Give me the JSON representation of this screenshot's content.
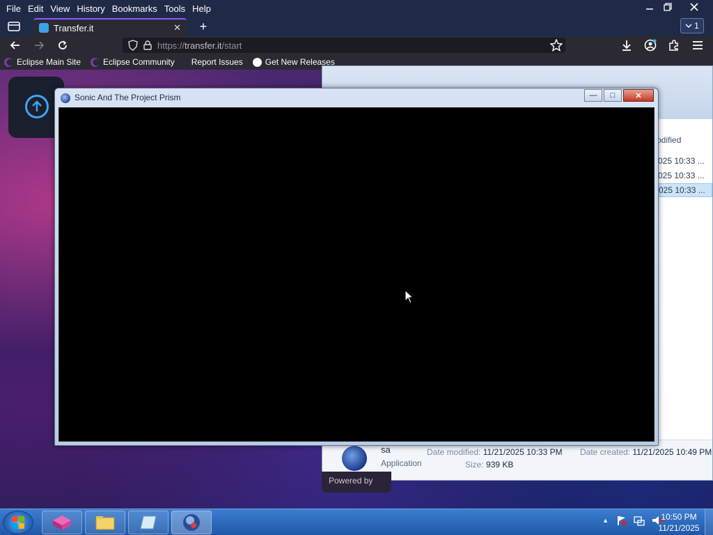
{
  "browser": {
    "menu": [
      "File",
      "Edit",
      "View",
      "History",
      "Bookmarks",
      "Tools",
      "Help"
    ],
    "tab": {
      "title": "Transfer.it",
      "close_glyph": "✕"
    },
    "new_tab_glyph": "+",
    "tab_count": "1",
    "url": {
      "scheme": "https://",
      "host": "transfer.it",
      "path": "/start"
    },
    "bookmarks": [
      {
        "label": "Eclipse Main Site",
        "icon": "eclipse-icon"
      },
      {
        "label": "Eclipse Community",
        "icon": "eclipse-icon"
      },
      {
        "label": "Report Issues",
        "icon": ""
      },
      {
        "label": "Get New Releases",
        "icon": "github-icon"
      }
    ],
    "colors": {
      "accent": "#9059ff",
      "chrome": "#1f2a47",
      "toolbar": "#2b2a33"
    }
  },
  "explorer": {
    "column_header": "odified",
    "rows": [
      "025 10:33 ...",
      "025 10:33 ...",
      "025 10:33 ..."
    ],
    "details": {
      "name": "sa",
      "type": "Application",
      "date_modified_label": "Date modified:",
      "date_modified": "11/21/2025 10:33 PM",
      "size_label": "Size:",
      "size": "939 KB",
      "date_created_label": "Date created:",
      "date_created": "11/21/2025 10:49 PM"
    },
    "powered_by": "Powered by"
  },
  "game_window": {
    "title": "Sonic And The Project Prism",
    "minimize_glyph": "—",
    "maximize_glyph": "□",
    "close_glyph": "✕"
  },
  "taskbar": {
    "clock_time": "10:50 PM",
    "clock_date": "11/21/2025",
    "tray_expand_glyph": "▲"
  }
}
